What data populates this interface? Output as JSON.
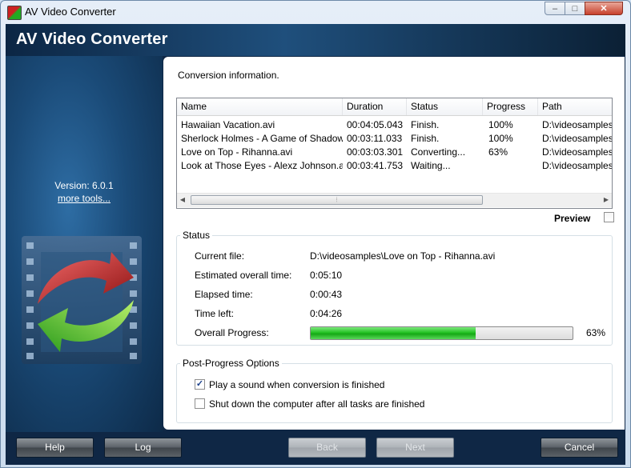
{
  "window": {
    "title": "AV Video Converter",
    "minimize_glyph": "–",
    "maximize_glyph": "□",
    "close_glyph": "✕"
  },
  "header": {
    "app_name": "AV Video Converter"
  },
  "left": {
    "version": "Version: 6.0.1",
    "more_tools": "more tools..."
  },
  "main": {
    "section_title": "Conversion information.",
    "columns": [
      "Name",
      "Duration",
      "Status",
      "Progress",
      "Path"
    ],
    "rows": [
      {
        "name": "Hawaiian Vacation.avi",
        "duration": "00:04:05.043",
        "status": "Finish.",
        "progress": "100%",
        "path": "D:\\videosamples\\"
      },
      {
        "name": "Sherlock Holmes - A Game of Shadows....",
        "duration": "00:03:11.033",
        "status": "Finish.",
        "progress": "100%",
        "path": "D:\\videosamples\\"
      },
      {
        "name": "Love on Top - Rihanna.avi",
        "duration": "00:03:03.301",
        "status": "Converting...",
        "progress": "63%",
        "path": "D:\\videosamples\\"
      },
      {
        "name": "Look at Those Eyes - Alexz Johnson.avi",
        "duration": "00:03:41.753",
        "status": "Waiting...",
        "progress": "",
        "path": "D:\\videosamples\\"
      }
    ],
    "preview_label": "Preview",
    "preview_checked": false
  },
  "status": {
    "title": "Status",
    "current_file_label": "Current file:",
    "current_file": "D:\\videosamples\\Love on Top - Rihanna.avi",
    "estimated_label": "Estimated overall time:",
    "estimated": "0:05:10",
    "elapsed_label": "Elapsed time:",
    "elapsed": "0:00:43",
    "time_left_label": "Time left:",
    "time_left": "0:04:26",
    "overall_label": "Overall Progress:",
    "overall_percent_text": "63%",
    "overall_fraction": 0.63
  },
  "post": {
    "title": "Post-Progress Options",
    "play_sound_label": "Play a sound when conversion is finished",
    "play_sound_checked": true,
    "shutdown_label": "Shut down the computer after all tasks are finished",
    "shutdown_checked": false
  },
  "buttons": {
    "help": "Help",
    "log": "Log",
    "back": "Back",
    "next": "Next",
    "cancel": "Cancel"
  },
  "colors": {
    "progress_green": "#1db31d",
    "header_dark": "#0c2644",
    "content_bg": "#ffffff"
  }
}
